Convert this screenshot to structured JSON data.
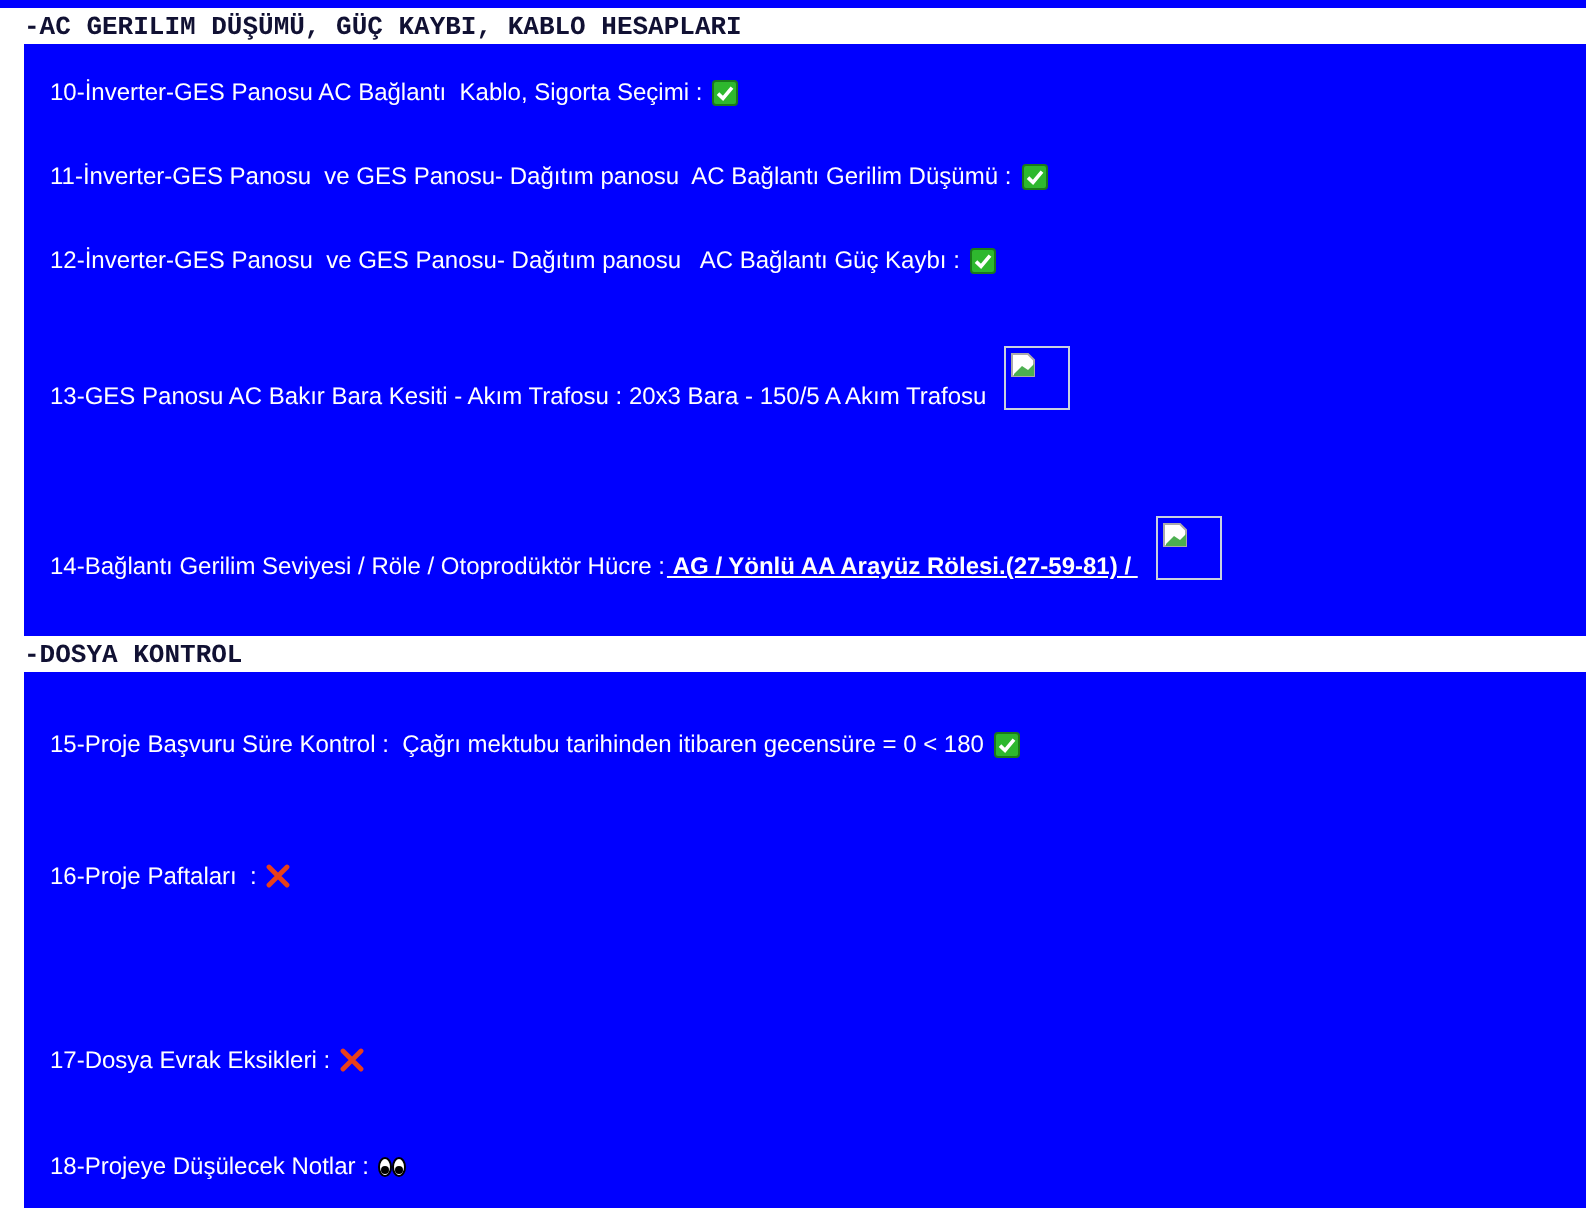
{
  "sections": [
    {
      "title": "-AC GERILIM DÜŞÜMÜ, GÜÇ KAYBI, KABLO HESAPLARI",
      "items": [
        {
          "label": "10-İnverter-GES Panosu AC Bağlantı  Kablo, Sigorta Seçimi :",
          "kind": "check"
        },
        {
          "label": "11-İnverter-GES Panosu  ve GES Panosu- Dağıtım panosu  AC Bağlantı Gerilim Düşümü :",
          "kind": "check"
        },
        {
          "label": "12-İnverter-GES Panosu  ve GES Panosu- Dağıtım panosu   AC Bağlantı Güç Kaybı :",
          "kind": "check"
        },
        {
          "label": "13-GES Panosu AC Bakır Bara Kesiti - Akım Trafosu : 20x3 Bara - 150/5 A Akım Trafosu",
          "kind": "image"
        },
        {
          "label": "14-Bağlantı Gerilim Seviyesi / Röle / Otoprodüktör Hücre :",
          "link": "AG / Yönlü AA Arayüz Rölesi.(27-59-81) /",
          "kind": "image"
        }
      ]
    },
    {
      "title": "-DOSYA KONTROL",
      "items": [
        {
          "label": "15-Proje Başvuru Süre Kontrol :  Çağrı mektubu tarihinden itibaren gecensüre = 0 < 180",
          "kind": "check"
        },
        {
          "label": "16-Proje Paftaları  :",
          "kind": "cross"
        },
        {
          "label": "17-Dosya Evrak Eksikleri :",
          "kind": "cross"
        },
        {
          "label": "18-Projeye Düşülecek Notlar :",
          "kind": "eyes"
        }
      ]
    }
  ]
}
